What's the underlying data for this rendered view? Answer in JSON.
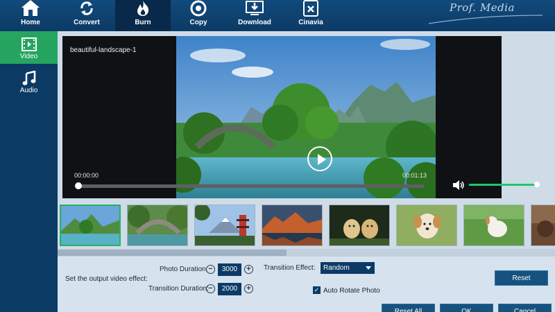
{
  "nav": {
    "home": "Home",
    "convert": "Convert",
    "burn": "Burn",
    "copy": "Copy",
    "download": "Download",
    "cinavia": "Cinavia"
  },
  "brand": "Prof. Media",
  "sidebar": {
    "video": "Video",
    "audio": "Audio"
  },
  "player": {
    "clip_title": "beautiful-landscape-1",
    "current_time": "00:00:00",
    "total_time": "00:01:13",
    "progress": 0.0,
    "volume": 1.0
  },
  "thumbnails": [
    {
      "name": "river-bridge-landscape",
      "selected": true
    },
    {
      "name": "stone-bridge-forest",
      "selected": false
    },
    {
      "name": "pagoda-mount-fuji",
      "selected": false
    },
    {
      "name": "red-mountains-lake",
      "selected": false
    },
    {
      "name": "two-puppies",
      "selected": false
    },
    {
      "name": "puppy-in-grass",
      "selected": false
    },
    {
      "name": "white-puppy-field",
      "selected": false
    },
    {
      "name": "partial-image",
      "selected": false
    }
  ],
  "settings": {
    "section_label": "Set the output video effect:",
    "photo_duration_label": "Photo Duration:",
    "photo_duration_value": "3000",
    "transition_duration_label": "Transition Duration:",
    "transition_duration_value": "2000",
    "transition_effect_label": "Transition Effect:",
    "transition_effect_value": "Random",
    "auto_rotate_label": "Auto Rotate Photo",
    "auto_rotate_checked": true,
    "reset_label": "Reset"
  },
  "footer": {
    "reset_all": "Reset All",
    "ok": "OK",
    "cancel": "Cancel"
  },
  "colors": {
    "nav_bg": "#0c3a66",
    "active_green": "#25a560",
    "volume_green": "#1ec86a",
    "panel_bg": "#d6e2ee"
  }
}
